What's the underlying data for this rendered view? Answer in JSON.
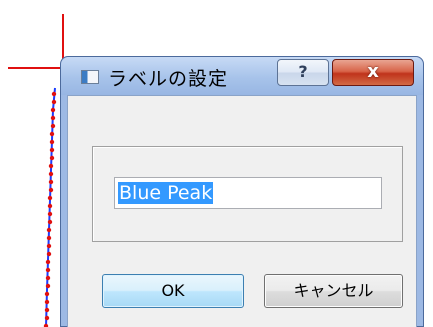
{
  "dialog": {
    "title": "ラベルの設定",
    "help_glyph": "?",
    "close_glyph": "x",
    "input_value": "Blue Peak",
    "ok_label": "OK",
    "cancel_label": "キャンセル"
  },
  "colors": {
    "crosshair": "#e01010",
    "plot_line": "#1a3cff",
    "plot_marker": "#e01010",
    "selection": "#3399ff"
  },
  "icons": [
    "app-window-icon",
    "help-icon",
    "close-icon"
  ]
}
